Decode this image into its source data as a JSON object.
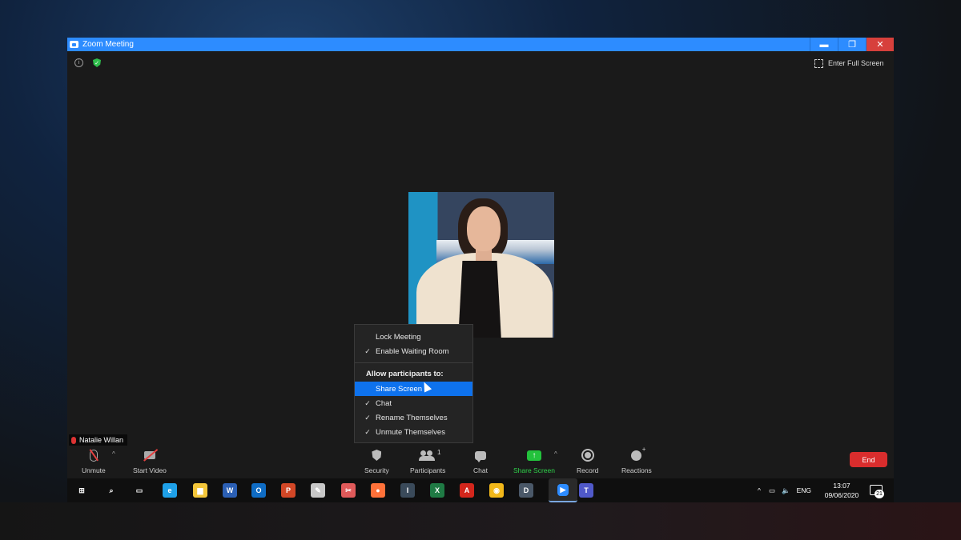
{
  "window": {
    "title": "Zoom Meeting",
    "minimize": "▬",
    "restore": "❐",
    "close": "✕"
  },
  "top": {
    "full_screen_label": "Enter Full Screen"
  },
  "participant": {
    "name": "Natalie Willan"
  },
  "security_menu": {
    "items": [
      {
        "label": "Lock Meeting",
        "checked": ""
      },
      {
        "label": "Enable Waiting Room",
        "checked": "✓"
      }
    ],
    "section_header": "Allow participants to:",
    "participant_items": [
      {
        "label": "Share Screen",
        "checked": ""
      },
      {
        "label": "Chat",
        "checked": "✓"
      },
      {
        "label": "Rename Themselves",
        "checked": "✓"
      },
      {
        "label": "Unmute Themselves",
        "checked": "✓"
      }
    ]
  },
  "toolbar": {
    "unmute": "Unmute",
    "start_video": "Start Video",
    "security": "Security",
    "participants": "Participants",
    "participants_count": "1",
    "chat": "Chat",
    "share_screen": "Share Screen",
    "record": "Record",
    "reactions": "Reactions",
    "end": "End",
    "caret": "^"
  },
  "taskbar": {
    "apps": [
      {
        "name": "windows-start-icon",
        "glyph": "⊞",
        "color": "#ffffff"
      },
      {
        "name": "search-icon",
        "glyph": "⌕",
        "color": "#ffffff"
      },
      {
        "name": "task-view-icon",
        "glyph": "▭",
        "color": "#ffffff"
      },
      {
        "name": "internet-explorer-icon",
        "glyph": "e",
        "color": "#1ea0e8"
      },
      {
        "name": "file-explorer-icon",
        "glyph": "▆",
        "color": "#f3c63a"
      },
      {
        "name": "word-icon",
        "glyph": "W",
        "color": "#2b5fb4"
      },
      {
        "name": "outlook-icon",
        "glyph": "O",
        "color": "#0f6cc4"
      },
      {
        "name": "powerpoint-icon",
        "glyph": "P",
        "color": "#d24726"
      },
      {
        "name": "paint-icon",
        "glyph": "✎",
        "color": "#c7c7c7"
      },
      {
        "name": "snipping-tool-icon",
        "glyph": "✂",
        "color": "#e05a5a"
      },
      {
        "name": "firefox-icon",
        "glyph": "●",
        "color": "#ff7139"
      },
      {
        "name": "iris-app-icon",
        "glyph": "I",
        "color": "#3a4a5a"
      },
      {
        "name": "excel-icon",
        "glyph": "X",
        "color": "#1f7a44"
      },
      {
        "name": "acrobat-icon",
        "glyph": "A",
        "color": "#d3261c"
      },
      {
        "name": "chrome-icon",
        "glyph": "◉",
        "color": "#f2b81a"
      },
      {
        "name": "iris-d-icon",
        "glyph": "D",
        "color": "#4a5868"
      },
      {
        "name": "zoom-icon",
        "glyph": "▶",
        "color": "#2d8cff"
      },
      {
        "name": "teams-icon",
        "glyph": "T",
        "color": "#5059c9"
      }
    ],
    "tray_chevron": "^",
    "network": "▭",
    "volume": "🔈",
    "language": "ENG",
    "time": "13:07",
    "date": "09/06/2020",
    "notifications": "21"
  }
}
